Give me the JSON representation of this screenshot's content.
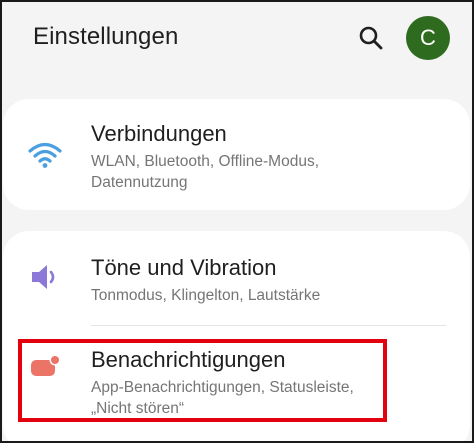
{
  "header": {
    "title": "Einstellungen",
    "search_icon": "search-icon",
    "avatar_letter": "C",
    "avatar_color": "#2e6b1f"
  },
  "settings": [
    {
      "title": "Verbindungen",
      "subtitle_line1": "WLAN, Bluetooth, Offline-Modus,",
      "subtitle_line2": "Datennutzung",
      "icon": "wifi-icon",
      "icon_color": "#4a9fe0"
    },
    {
      "title": "Töne und Vibration",
      "subtitle_line1": "Tonmodus, Klingelton, Lautstärke",
      "icon": "speaker-icon",
      "icon_color": "#8b78d8"
    },
    {
      "title": "Benachrichtigungen",
      "subtitle_line1": "App-Benachrichtigungen, Statusleiste,",
      "subtitle_line2": "„Nicht stören“",
      "icon": "notification-icon",
      "icon_color": "#ec7466"
    }
  ],
  "highlight_color": "#e3000f"
}
